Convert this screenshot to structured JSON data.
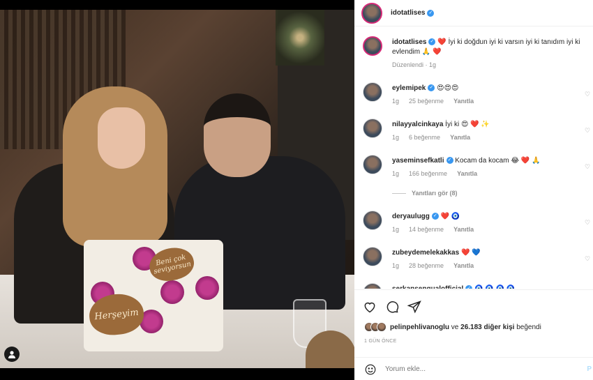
{
  "photo": {
    "plaque_a": "Herşeyim",
    "plaque_b": "Beni çok seviyorsun"
  },
  "header": {
    "username": "idotatlises"
  },
  "caption": {
    "username": "idotatlises",
    "text": "❤️ İyi ki doğdun iyi ki varsın iyi ki tanıdım iyi ki evlendim 🙏 ❤️",
    "edited": "Düzenlendi · 1g"
  },
  "comments": [
    {
      "username": "eylemipek",
      "verified": true,
      "text": "😍😍😍",
      "time": "1g",
      "likes": "25 beğenme",
      "reply": "Yanıtla"
    },
    {
      "username": "nilayyalcinkaya",
      "verified": false,
      "text": "İyi ki 😍 ❤️ ✨",
      "time": "1g",
      "likes": "6 beğenme",
      "reply": "Yanıtla"
    },
    {
      "username": "yaseminsefkatli",
      "verified": true,
      "text": "Kocam da kocam 😂 ❤️ 🙏",
      "time": "1g",
      "likes": "166 beğenme",
      "reply": "Yanıtla"
    },
    {
      "username": "deryaulugg",
      "verified": true,
      "text": "❤️ 🧿",
      "time": "1g",
      "likes": "14 beğenme",
      "reply": "Yanıtla"
    },
    {
      "username": "zubeydemelekakkas",
      "verified": false,
      "text": "❤️ 💙",
      "time": "1g",
      "likes": "28 beğenme",
      "reply": "Yanıtla"
    },
    {
      "username": "serkansenqualofficial",
      "verified": true,
      "text": "🧿 🧿 🧿 🧿",
      "time": "",
      "likes": "",
      "reply": ""
    }
  ],
  "view_replies": "Yanıtları gör (8)",
  "likes": {
    "user": "pelinpehlivanoglu",
    "connector": "ve",
    "others": "26.183 diğer kişi",
    "suffix": "beğendi"
  },
  "date": "1 GÜN ÖNCE",
  "add_comment": {
    "placeholder": "Yorum ekle...",
    "post": "P"
  },
  "colors": {
    "verified": "#3897f0",
    "story_ring": "#d62976",
    "link": "#b2dffc"
  }
}
